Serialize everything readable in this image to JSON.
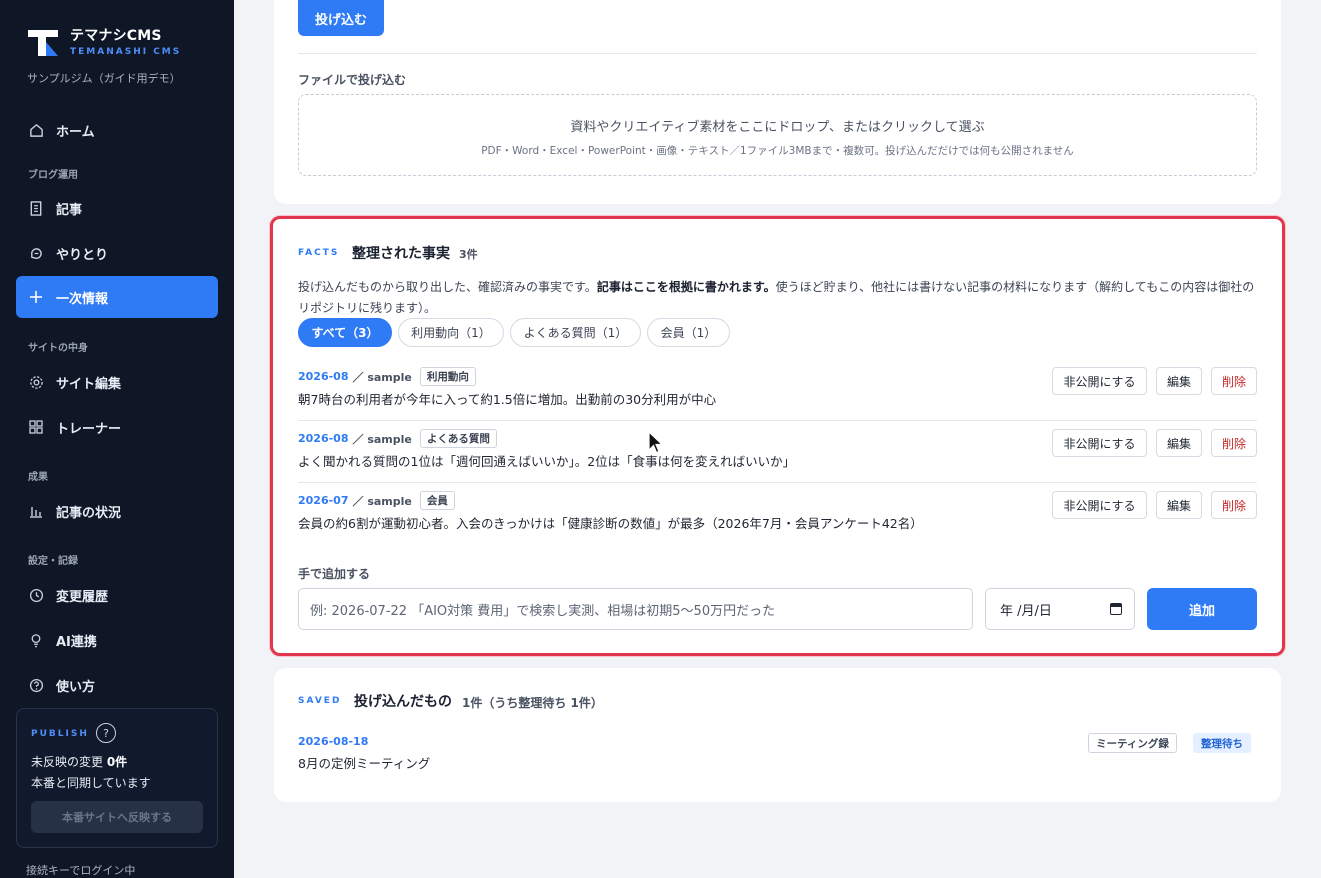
{
  "sidebar": {
    "logo_title": "テマナシCMS",
    "logo_sub": "TEMANASHI CMS",
    "gym_name": "サンプルジム（ガイド用デモ）",
    "home": "ホーム",
    "section_blog": "ブログ運用",
    "articles": "記事",
    "conversations": "やりとり",
    "primary_info": "一次情報",
    "section_site": "サイトの中身",
    "site_edit": "サイト編集",
    "trainers": "トレーナー",
    "section_results": "成果",
    "article_status": "記事の状況",
    "section_settings": "設定・記録",
    "history": "変更履歴",
    "ai": "AI連携",
    "howto": "使い方",
    "publish": {
      "heading": "PUBLISH",
      "help": "?",
      "pending_prefix": "未反映の変更 ",
      "pending_count": "0件",
      "synced": "本番と同期しています",
      "button": "本番サイトへ反映する"
    },
    "login_status": "接続キーでログイン中"
  },
  "upload": {
    "submit_button": "投げ込む",
    "file_label": "ファイルで投げ込む",
    "drop_main": "資料やクリエイティブ素材をここにドロップ、またはクリックして選ぶ",
    "drop_sub": "PDF・Word・Excel・PowerPoint・画像・テキスト／1ファイル3MBまで・複数可。投げ込んだだけでは何も公開されません"
  },
  "facts": {
    "tag": "FACTS",
    "title": "整理された事実",
    "count": "3件",
    "desc_pre": "投げ込んだものから取り出した、確認済みの事実です。",
    "desc_bold": "記事はここを根拠に書かれます。",
    "desc_post": "使うほど貯まり、他社には書けない記事の材料になります（解約してもこの内容は御社のリポジトリに残ります）。",
    "filters": [
      {
        "label": "すべて（3）"
      },
      {
        "label": "利用動向（1）"
      },
      {
        "label": "よくある質問（1）"
      },
      {
        "label": "会員（1）"
      }
    ],
    "items": [
      {
        "date": "2026-08",
        "source": "／ sample",
        "tag": "利用動向",
        "text": "朝7時台の利用者が今年に入って約1.5倍に増加。出勤前の30分利用が中心"
      },
      {
        "date": "2026-08",
        "source": "／ sample",
        "tag": "よくある質問",
        "text": "よく聞かれる質問の1位は「週何回通えばいいか」。2位は「食事は何を変えればいいか」"
      },
      {
        "date": "2026-07",
        "source": "／ sample",
        "tag": "会員",
        "text": "会員の約6割が運動初心者。入会のきっかけは「健康診断の数値」が最多（2026年7月・会員アンケート42名）"
      }
    ],
    "actions": {
      "hide": "非公開にする",
      "edit": "編集",
      "delete": "削除"
    },
    "manual_label": "手で追加する",
    "manual_placeholder": "例: 2026-07-22 「AIO対策 費用」で検索し実測、相場は初期5〜50万円だった",
    "date_placeholder": "年 /月/日",
    "add_button": "追加"
  },
  "saved": {
    "tag": "SAVED",
    "title": "投げ込んだもの",
    "count": "1件（うち整理待ち 1件）",
    "item_date": "2026-08-18",
    "item_text": "8月の定例ミーティング",
    "item_kind": "ミーティング録",
    "item_status": "整理待ち"
  },
  "colors": {
    "accent": "#2f7bf5",
    "sidebar_bg": "#0f1626",
    "highlight_border": "#e2364f",
    "delete": "#c62828"
  }
}
